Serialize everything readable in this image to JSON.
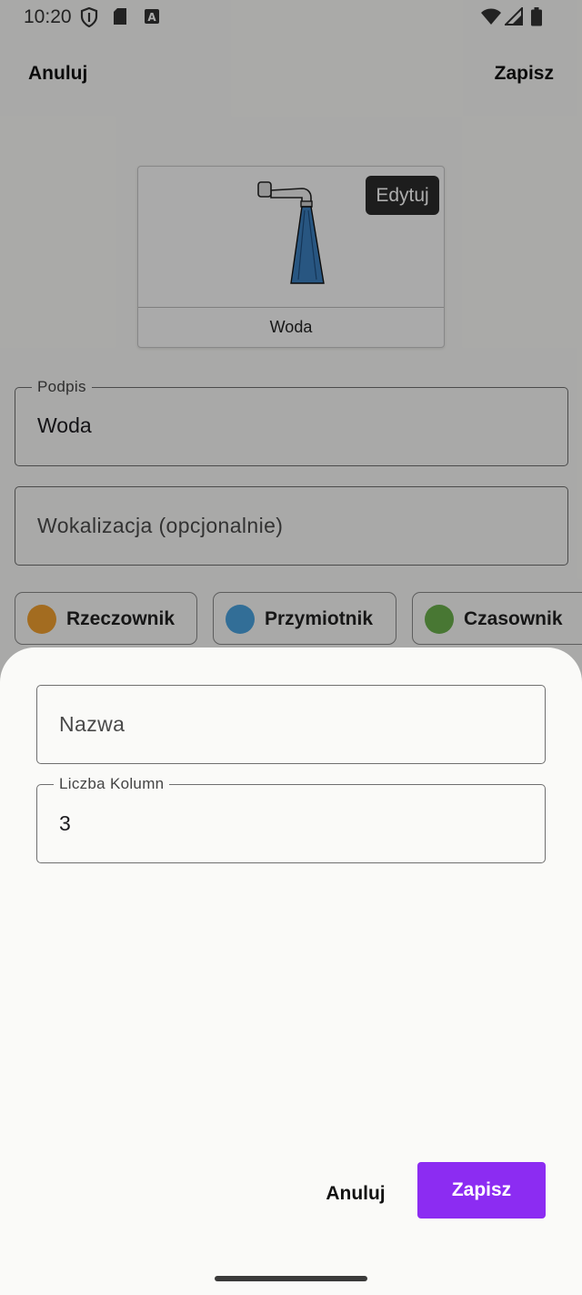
{
  "status_bar": {
    "time": "10:20",
    "left_icons": [
      "shield-icon",
      "sd-card-icon",
      "a-notification-icon"
    ],
    "right_icons": [
      "wifi-icon",
      "signal-icon",
      "battery-icon"
    ]
  },
  "top_bar": {
    "cancel": "Anuluj",
    "save": "Zapisz"
  },
  "tile": {
    "label": "Woda",
    "edit": "Edytuj",
    "image": "faucet-water-icon"
  },
  "caption_field": {
    "legend": "Podpis",
    "value": "Woda"
  },
  "vocalization_field": {
    "placeholder": "Wokalizacja (opcjonalnie)"
  },
  "chips": [
    {
      "label": "Rzeczownik",
      "color": "#f0a030"
    },
    {
      "label": "Przymiotnik",
      "color": "#4aa3df"
    },
    {
      "label": "Czasownik",
      "color": "#6ab04c"
    }
  ],
  "sheet": {
    "name_field": {
      "placeholder": "Nazwa"
    },
    "columns_field": {
      "legend": "Liczba Kolumn",
      "value": "3"
    },
    "cancel": "Anuluj",
    "save": "Zapisz"
  },
  "colors": {
    "accent": "#8c2cf2",
    "scrim": "rgba(0,0,0,0.32)"
  }
}
